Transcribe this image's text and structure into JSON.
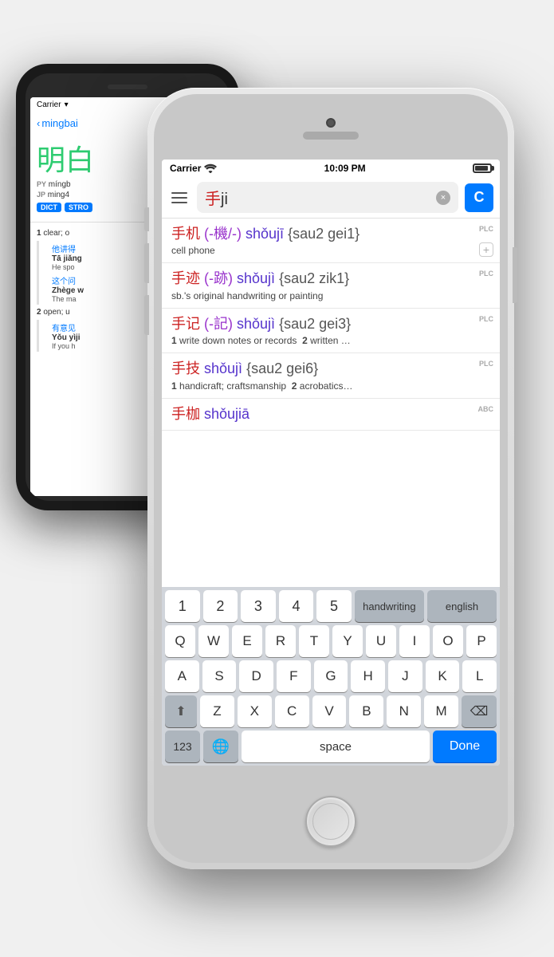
{
  "scene": {
    "background": "#f0f0f0"
  },
  "black_phone": {
    "status": {
      "carrier": "Carrier",
      "signal": "wifi"
    },
    "nav": {
      "back_label": "mingbai",
      "back_icon": "‹"
    },
    "title": {
      "chinese": "明白",
      "label": "明白"
    },
    "pinyin_row": {
      "py_label": "PY",
      "py_value": "míngb",
      "jp_label": "JP",
      "jp_value": "ming4"
    },
    "tags": [
      "DICT",
      "STRO"
    ],
    "definitions": [
      {
        "num": "1",
        "text": "clear; o",
        "examples": [
          {
            "cn": "他讲得",
            "py": "Tā jiǎng",
            "en": "He spo"
          },
          {
            "cn": "这个问",
            "py": "Zhège w",
            "en": "The ma"
          }
        ]
      },
      {
        "num": "2",
        "text": "open; u",
        "examples": [
          {
            "cn": "有意见",
            "py": "Yǒu yìji",
            "en": "If you h"
          }
        ]
      }
    ]
  },
  "white_phone": {
    "status_bar": {
      "carrier": "Carrier",
      "wifi": "wifi",
      "time": "10:09 PM",
      "battery": "full"
    },
    "search": {
      "menu_icon": "☰",
      "query_text_zh": "手",
      "query_text_latin": "ji",
      "clear_icon": "×",
      "voice_label": "C"
    },
    "results": [
      {
        "id": 1,
        "headword_zh": "手机",
        "headword_trad": "-機/-",
        "pinyin": "shǒujī",
        "jyutping": "{sau2 gei1}",
        "definition": "cell phone",
        "badge": "PLC",
        "has_plus": true
      },
      {
        "id": 2,
        "headword_zh": "手迹",
        "headword_trad": "-跡",
        "pinyin": "shǒujì",
        "jyutping": "{sau2 zik1}",
        "definition": "sb.'s original handwriting or painting",
        "badge": "PLC",
        "has_plus": false
      },
      {
        "id": 3,
        "headword_zh": "手记",
        "headword_trad": "-記",
        "pinyin": "shǒujì",
        "jyutping": "{sau2 gei3}",
        "definition_parts": [
          {
            "num": "1",
            "text": "write down notes or records"
          },
          {
            "num": "2",
            "text": "written …"
          }
        ],
        "badge": "PLC",
        "has_plus": false
      },
      {
        "id": 4,
        "headword_zh": "手技",
        "headword_trad": "",
        "pinyin": "shǒujì",
        "jyutping": "{sau2 gei6}",
        "definition_parts": [
          {
            "num": "1",
            "text": "handicraft; craftsmanship"
          },
          {
            "num": "2",
            "text": "acrobatics…"
          }
        ],
        "badge": "PLC",
        "has_plus": false
      },
      {
        "id": 5,
        "headword_zh": "手枷",
        "headword_trad": "",
        "pinyin": "shǒujiā",
        "jyutping": "",
        "definition": "",
        "badge": "ABC",
        "has_plus": false
      }
    ],
    "keyboard": {
      "top_row_nums": [
        "1",
        "2",
        "3",
        "4",
        "5"
      ],
      "top_row_special": [
        "handwriting",
        "english"
      ],
      "row1": [
        "Q",
        "W",
        "E",
        "R",
        "T",
        "Y",
        "U",
        "I",
        "O",
        "P"
      ],
      "row2": [
        "A",
        "S",
        "D",
        "F",
        "G",
        "H",
        "J",
        "K",
        "L"
      ],
      "row3_mid": [
        "Z",
        "X",
        "C",
        "V",
        "B",
        "N",
        "M"
      ],
      "shift_icon": "⬆",
      "delete_icon": "⌫",
      "num_label": "123",
      "globe_icon": "🌐",
      "space_label": "space",
      "done_label": "Done"
    }
  }
}
